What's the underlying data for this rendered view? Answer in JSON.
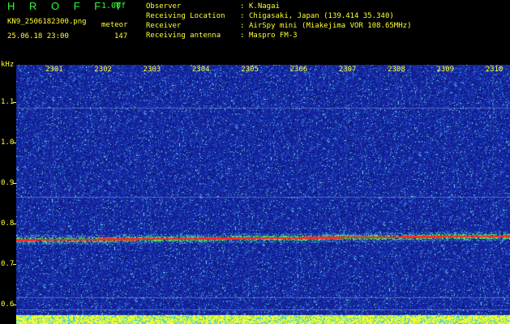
{
  "header": {
    "app_title": "H R O F F T",
    "version": "1.00f",
    "filename": "KN9_2506182300.png",
    "program": "meteor",
    "datetime": "25.06.18 23:00",
    "count": "147"
  },
  "info": [
    {
      "label": "Observer",
      "value": "K.Nagai"
    },
    {
      "label": "Receiving Location",
      "value": "Chigasaki, Japan (139.414 35.340)"
    },
    {
      "label": "Receiver",
      "value": "AirSpy mini (Miakejima VOR 108.65MHz)"
    },
    {
      "label": "Receiving antenna",
      "value": "Maspro FM-3"
    }
  ],
  "spectrogram": {
    "y_unit": "kHz",
    "y_ticks": [
      "1.1",
      "1.0",
      "0.9",
      "0.8",
      "0.7",
      "0.6"
    ],
    "x_ticks": [
      "2301",
      "2302",
      "2303",
      "2304",
      "2305",
      "2306",
      "2307",
      "2308",
      "2309",
      "2310"
    ],
    "carrier_khz": 0.76,
    "background_color": "#1a2aa8",
    "carrier_color": "#ff2020",
    "label_color": "#ffff33",
    "title_color": "#33ff33"
  }
}
